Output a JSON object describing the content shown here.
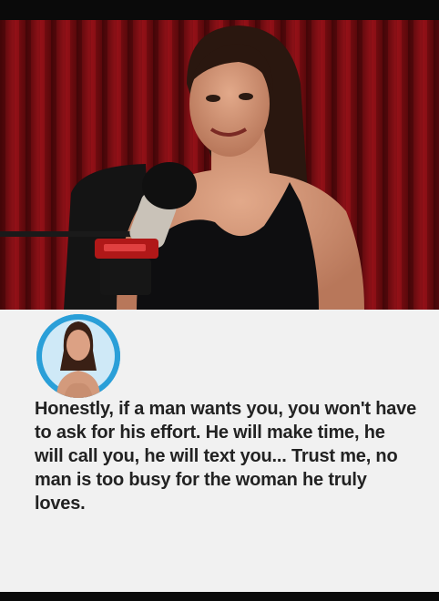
{
  "post": {
    "quote_text": "Honestly, if a man wants you, you won't have to ask for his effort. He will make time, he will call you, he will text you... Trust me, no man is too busy for the woman he truly loves."
  },
  "colors": {
    "curtain": "#7a0d12",
    "avatar_ring": "#2a9fd8",
    "caption_background": "#f1f1f1",
    "quote_text": "#222222"
  },
  "icons": {
    "microphone": "microphone-icon"
  }
}
